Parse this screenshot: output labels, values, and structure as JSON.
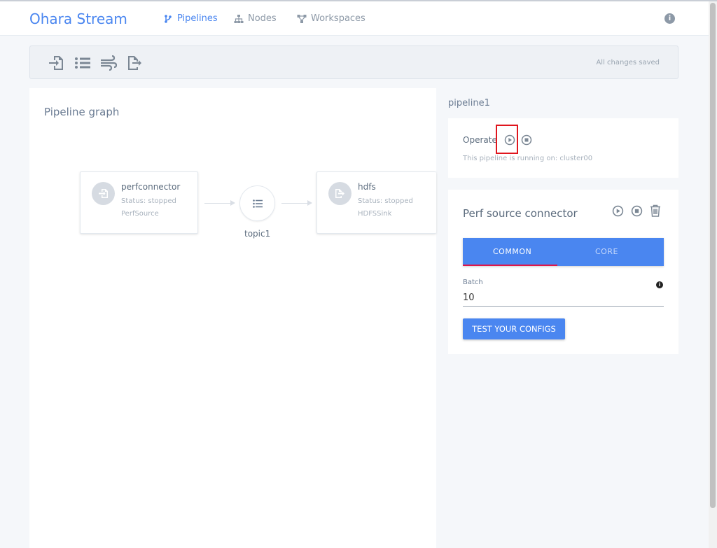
{
  "nav": {
    "brand": "Ohara Stream",
    "links": [
      {
        "label": "Pipelines",
        "icon": "branch-icon",
        "active": true
      },
      {
        "label": "Nodes",
        "icon": "sitemap-icon",
        "active": false
      },
      {
        "label": "Workspaces",
        "icon": "network-icon",
        "active": false
      }
    ],
    "info_icon": "i"
  },
  "toolbar": {
    "tools": [
      "source-connector-icon",
      "topic-list-icon",
      "stream-app-icon",
      "sink-connector-icon"
    ],
    "status": "All changes saved"
  },
  "graph": {
    "title": "Pipeline graph",
    "nodes": [
      {
        "name": "perfconnector",
        "status": "Status: stopped",
        "type": "PerfSource"
      },
      {
        "name": "hdfs",
        "status": "Status: stopped",
        "type": "HDFSSink"
      }
    ],
    "topic": {
      "name": "topic1"
    }
  },
  "pipeline": {
    "name": "pipeline1",
    "operate_label": "Operate",
    "running_text": "This pipeline is running on: cluster00"
  },
  "connector": {
    "title": "Perf source connector",
    "tabs": [
      "COMMON",
      "CORE"
    ],
    "active_tab": "COMMON",
    "batch_label": "Batch",
    "batch_value": "10",
    "test_button": "TEST YOUR CONFIGS"
  },
  "colors": {
    "accent": "#4a86f0",
    "tab_indicator": "#e0164a",
    "highlight": "#e0161e"
  }
}
